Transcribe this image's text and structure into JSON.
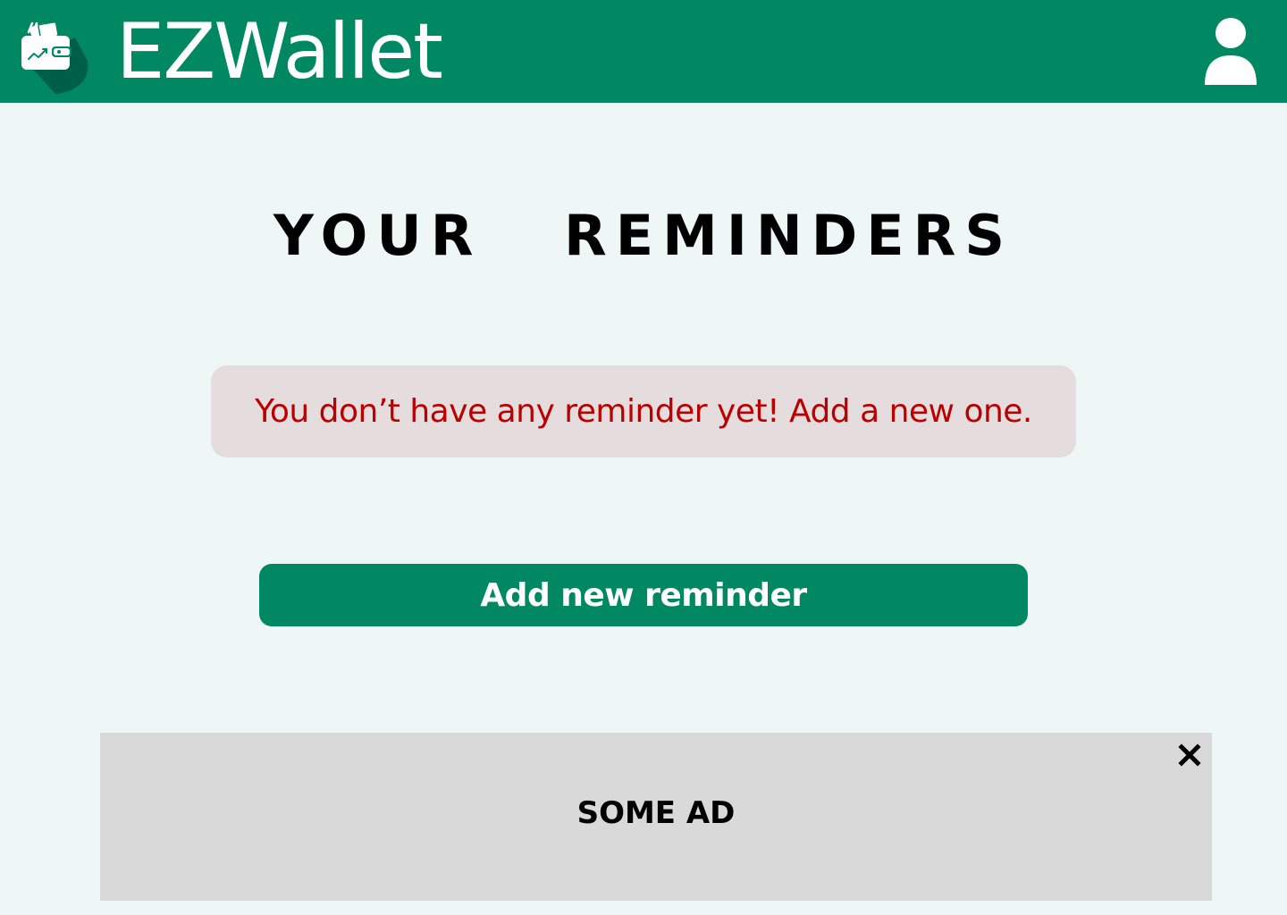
{
  "header": {
    "app_name": "EZWallet",
    "logo_icon": "wallet-icon",
    "profile_icon": "user-icon"
  },
  "main": {
    "title": "YOUR REMINDERS",
    "empty_message": "You don’t have any reminder yet! Add a new one.",
    "add_button_label": "Add new reminder"
  },
  "ad": {
    "label": "SOME AD",
    "close_icon": "close-icon"
  },
  "colors": {
    "brand_green": "#008862",
    "background": "#eef7f5",
    "error_text": "#bb0000",
    "error_bg": "#e5dcdd",
    "ad_bg": "#d9d9d9"
  }
}
